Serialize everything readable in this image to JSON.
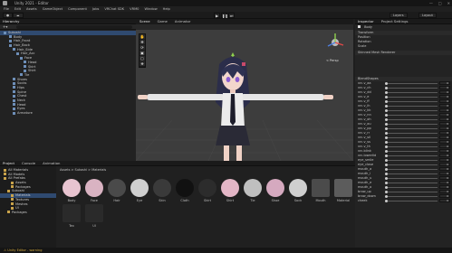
{
  "title": "Unity 2021 - Editor",
  "menu": [
    "File",
    "Edit",
    "Assets",
    "GameObject",
    "Component",
    "Jobs",
    "VRChat SDK",
    "VRM0",
    "Window",
    "Help"
  ],
  "colors": {
    "accent": "#2f4a70",
    "panel": "#222222",
    "scene_bg": "#3d3d3d",
    "warning": "#d2a83b"
  },
  "toolbar": {
    "layers_label": "Layers",
    "layout_label": "Layout"
  },
  "hierarchy": {
    "tab_label": "Hierarchy",
    "items": [
      "Sukoshi",
      "Body",
      "Hair_Front",
      "Hair_Back",
      "Hair_Side",
      "Hair_Acc",
      "Face",
      "Head",
      "Skirt",
      "Shirt",
      "Tie",
      "Shoes",
      "Socks",
      "Hips",
      "Spine",
      "Chest",
      "Neck",
      "Head",
      "Eyes",
      "Armature"
    ]
  },
  "scene": {
    "tabs": [
      "Scene",
      "Game",
      "Animator"
    ],
    "persp_label": "< Persp"
  },
  "inspector": {
    "tabs": [
      "Inspector",
      "Project Settings"
    ],
    "obj_name": "Body",
    "transform_label": "Transform",
    "position_label": "Position",
    "rotation_label": "Rotation",
    "scale_label": "Scale",
    "renderer_label": "Skinned Mesh Renderer",
    "blendshapes_label": "BlendShapes",
    "blendshapes": [
      {
        "name": "vrc.v_aa",
        "value": "0"
      },
      {
        "name": "vrc.v_ch",
        "value": "0"
      },
      {
        "name": "vrc.v_dd",
        "value": "0"
      },
      {
        "name": "vrc.v_e",
        "value": "0"
      },
      {
        "name": "vrc.v_ff",
        "value": "0"
      },
      {
        "name": "vrc.v_ih",
        "value": "0"
      },
      {
        "name": "vrc.v_kk",
        "value": "0"
      },
      {
        "name": "vrc.v_nn",
        "value": "0"
      },
      {
        "name": "vrc.v_oh",
        "value": "0"
      },
      {
        "name": "vrc.v_ou",
        "value": "0"
      },
      {
        "name": "vrc.v_pp",
        "value": "0"
      },
      {
        "name": "vrc.v_rr",
        "value": "0"
      },
      {
        "name": "vrc.v_sil",
        "value": "0"
      },
      {
        "name": "vrc.v_ss",
        "value": "0"
      },
      {
        "name": "vrc.v_th",
        "value": "0"
      },
      {
        "name": "vrc.blink",
        "value": "0"
      },
      {
        "name": "vrc.lowerlid",
        "value": "0"
      },
      {
        "name": "eye_smile",
        "value": "0"
      },
      {
        "name": "eye_close",
        "value": "0"
      },
      {
        "name": "mouth_a",
        "value": "0"
      },
      {
        "name": "mouth_i",
        "value": "0"
      },
      {
        "name": "mouth_u",
        "value": "0"
      },
      {
        "name": "mouth_e",
        "value": "0"
      },
      {
        "name": "mouth_o",
        "value": "0"
      },
      {
        "name": "brow_up",
        "value": "0"
      },
      {
        "name": "brow_down",
        "value": "0"
      },
      {
        "name": "cheek",
        "value": "0"
      }
    ]
  },
  "project": {
    "tabs": [
      "Project",
      "Console",
      "Animation"
    ],
    "breadcrumb": "Assets > Sukoshi > Materials",
    "tree": [
      "All Materials",
      "All Models",
      "All Prefabs",
      "Assets",
      "Packages",
      "Sukoshi",
      "Materials",
      "Textures",
      "Meshes",
      "UI",
      "Packages"
    ],
    "assets": [
      "Body",
      "Face",
      "Hair",
      "Eye",
      "Skin",
      "Cloth",
      "Skirt",
      "Shirt",
      "Tie",
      "Shoe",
      "Sock",
      "Mouth",
      "Material"
    ],
    "assets_row2": [
      "Tex",
      "UI"
    ]
  },
  "status": "Unity Editor - warning"
}
